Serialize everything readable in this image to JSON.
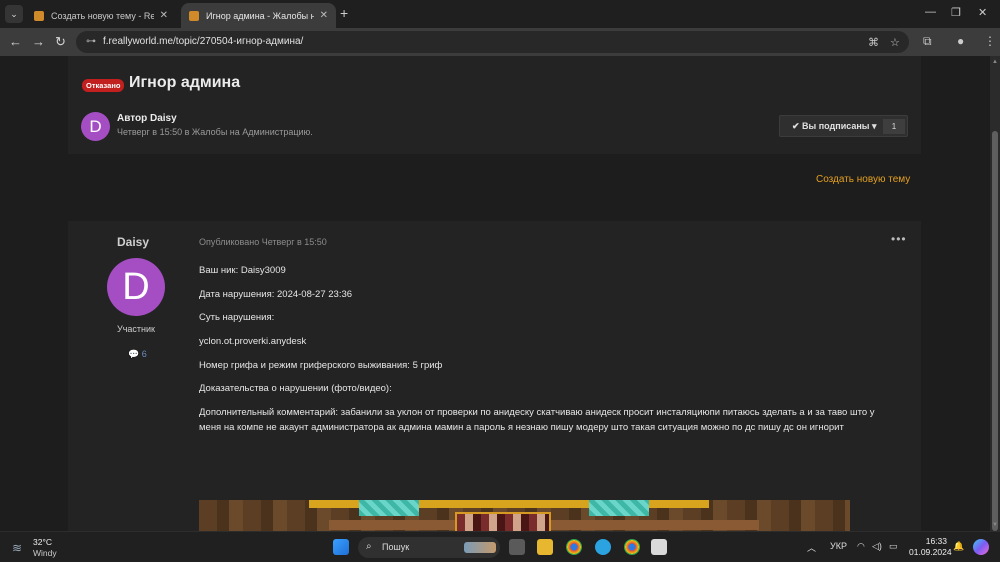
{
  "browser": {
    "tabs": [
      {
        "title": "Создать новую тему - ReallyWorld",
        "active": false
      },
      {
        "title": "Игнор админа - Жалобы на Администрацию",
        "active": true
      }
    ],
    "url": "f.reallyworld.me/topic/270504-игнор-админа/"
  },
  "topic": {
    "status_badge": "Отказано",
    "title": "Игнор админа",
    "author_label": "Автор Daisy",
    "avatar_letter": "D",
    "meta": "Четверг в 15:50 в Жалобы на Администрацию.",
    "subscribe_label": "Вы подписаны",
    "subscribe_count": "1",
    "new_topic_link": "Создать новую тему"
  },
  "post": {
    "author": "Daisy",
    "avatar_letter": "D",
    "role": "Участник",
    "post_count": "6",
    "published": "Опубликовано Четверг в 15:50",
    "more_label": "•••",
    "lines": [
      "Ваш ник: Daisy3009",
      "Дата нарушения: 2024-08-27 23:36",
      "Суть нарушения:",
      "yclon.ot.proverki.anydesk",
      "Номер грифа и режим гриферского выживания: 5 гриф",
      "Доказательства о нарушении (фото/видео):",
      "Дополнительный комментарий: забанили за уклон от проверки по анидеску скатчиваю анидеск просит инсталяциюпи питаюсь зделать а и за таво што у",
      "меня на компе не акаунт администратора ак админа мамин а пароль я незнаю пишу модеру што такая ситуация можно по дс пишу дс он игнорит"
    ]
  },
  "taskbar": {
    "temperature": "32°C",
    "weather": "Windy",
    "search_placeholder": "Пошук",
    "language": "УКР",
    "time": "16:33",
    "date": "01.09.2024"
  },
  "colors": {
    "accent_link": "#e4a020",
    "badge_red": "#c1201f",
    "avatar_purple": "#a54ec3"
  }
}
